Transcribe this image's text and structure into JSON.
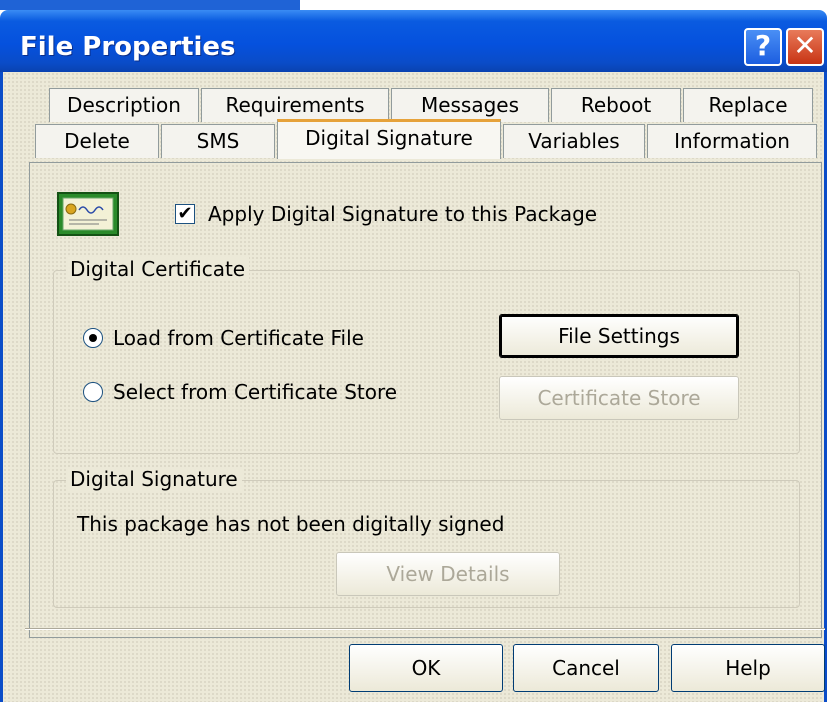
{
  "window": {
    "title": "File Properties",
    "help_glyph": "?",
    "close_glyph": "✕"
  },
  "tabs_row1": [
    "Description",
    "Requirements",
    "Messages",
    "Reboot",
    "Replace"
  ],
  "tabs_row2": [
    "Delete",
    "SMS",
    "Digital Signature",
    "Variables",
    "Information"
  ],
  "active_tab": "Digital Signature",
  "apply_checkbox": {
    "label": "Apply Digital Signature to this Package",
    "checked": true,
    "check_glyph": "✔"
  },
  "certificate_group": {
    "title": "Digital Certificate",
    "radio_file": {
      "label": "Load from Certificate File",
      "selected": true
    },
    "radio_store": {
      "label": "Select from Certificate Store",
      "selected": false
    },
    "file_settings_button": "File Settings",
    "certificate_store_button": "Certificate Store"
  },
  "signature_group": {
    "title": "Digital Signature",
    "status": "This package has not been digitally signed",
    "view_details_button": "View Details"
  },
  "footer": {
    "ok": "OK",
    "cancel": "Cancel",
    "help": "Help"
  },
  "colors": {
    "titlebar": "#0551de",
    "dialog_bg": "#ece9d8",
    "close": "#c83414",
    "active_tab_accent": "#e6a23a"
  },
  "icons": {
    "certificate": "certificate-icon"
  }
}
